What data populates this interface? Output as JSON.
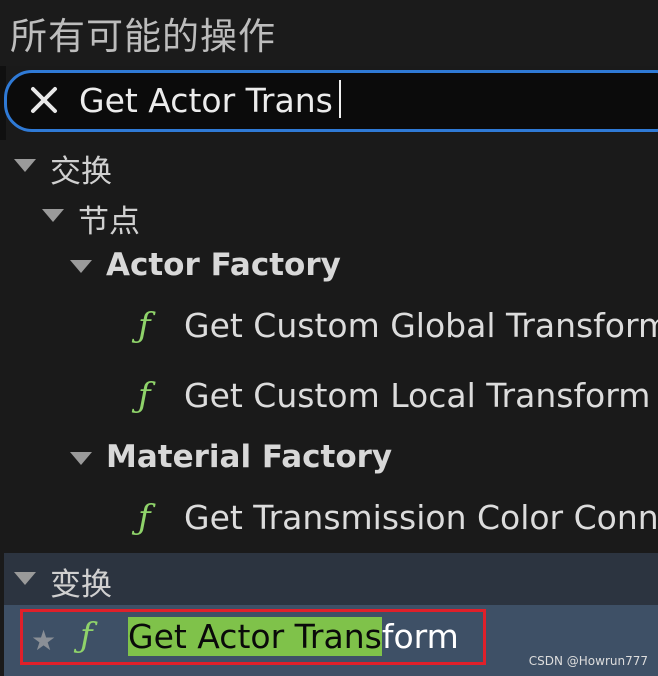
{
  "title": "所有可能的操作",
  "search": {
    "value": "Get Actor Trans",
    "close_icon": "close-icon"
  },
  "tree": {
    "category1": {
      "label": "交换",
      "sub": {
        "label": "节点",
        "groups": [
          {
            "label": "Actor Factory",
            "items": [
              {
                "icon": "function-icon",
                "label": "Get Custom Global Transform"
              },
              {
                "icon": "function-icon",
                "label": "Get Custom Local Transform"
              }
            ]
          },
          {
            "label": "Material Factory",
            "items": [
              {
                "icon": "function-icon",
                "label": "Get Transmission Color Conn"
              }
            ]
          }
        ]
      }
    },
    "category2": {
      "label": "变换",
      "selected_item": {
        "icon": "function-icon",
        "match_text": "Get Actor Trans",
        "rest_text": "form",
        "favorite_icon": "star-icon"
      }
    }
  },
  "fn_glyph": "ƒ",
  "star_glyph": "★",
  "watermark": "CSDN @Howrun777",
  "colors": {
    "accent": "#2f7ad6",
    "function_icon": "#8fd36a",
    "match_highlight": "#7fc24a",
    "selected_row": "#3e5066",
    "highlight_border": "#e0202a"
  }
}
